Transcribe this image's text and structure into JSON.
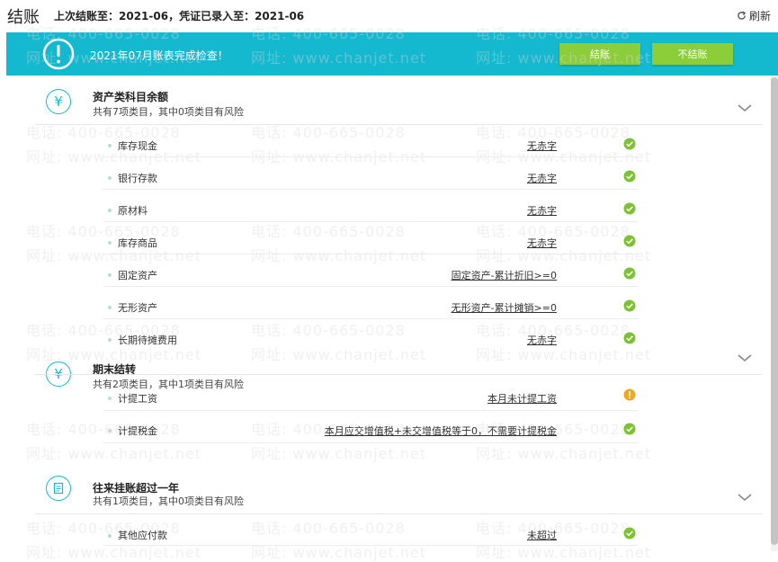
{
  "header": {
    "title": "结账",
    "status": "上次结账至：2021-06，凭证已录入至：2021-06",
    "refresh_label": "刷新"
  },
  "banner": {
    "message": "2021年07月账表完成检查！",
    "close_button": "结账",
    "noclose_button": "不结账"
  },
  "colors": {
    "accent": "#14b8cf",
    "button": "#8ccd3a",
    "ok": "#7cc232",
    "warn": "#f0a81e"
  },
  "sections": [
    {
      "icon": "yen-icon",
      "title": "资产类科目余额",
      "subtitle": "共有7项类目，其中0项类目有风险",
      "rows": [
        {
          "label": "库存现金",
          "result": "无赤字",
          "status": "ok"
        },
        {
          "label": "银行存款",
          "result": "无赤字",
          "status": "ok"
        },
        {
          "label": "原材料",
          "result": "无赤字",
          "status": "ok"
        },
        {
          "label": "库存商品",
          "result": "无赤字",
          "status": "ok"
        },
        {
          "label": "固定资产",
          "result": "固定资产-累计折旧>=0",
          "status": "ok"
        },
        {
          "label": "无形资产",
          "result": "无形资产-累计摊销>=0",
          "status": "ok"
        },
        {
          "label": "长期待摊费用",
          "result": "无赤字",
          "status": "ok"
        }
      ]
    },
    {
      "icon": "transfer-icon",
      "title": "期末结转",
      "subtitle": "共有2项类目，其中1项类目有风险",
      "rows": [
        {
          "label": "计提工资",
          "result": "本月未计提工资",
          "status": "warn"
        },
        {
          "label": "计提税金",
          "result": "本月应交增值税+未交增值税等于0，不需要计提税金",
          "status": "ok"
        }
      ]
    },
    {
      "icon": "ledger-icon",
      "title": "往来挂账超过一年",
      "subtitle": "共有1项类目，其中0项类目有风险",
      "rows": [
        {
          "label": "其他应付款",
          "result": "未超过",
          "status": "ok"
        }
      ]
    }
  ],
  "watermark": {
    "phone": "电话: 400-665-0028",
    "site": "网址: www.chanjet.net"
  }
}
